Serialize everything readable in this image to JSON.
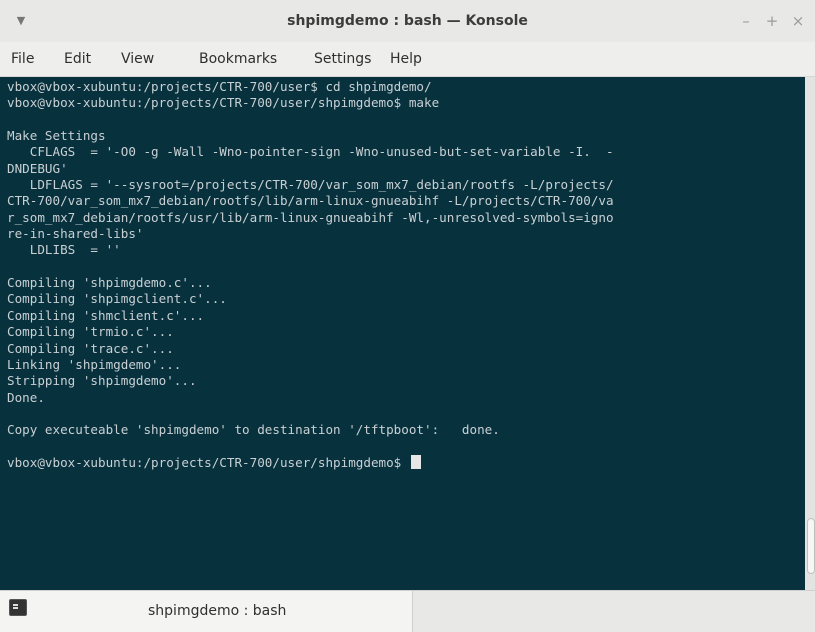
{
  "window": {
    "title": "shpimgdemo : bash — Konsole",
    "menu_icon": "chevron-down-icon",
    "controls": {
      "minimize": "–",
      "maximize": "+",
      "close": "×"
    }
  },
  "menubar": {
    "items": [
      "File",
      "Edit",
      "View",
      "Bookmarks",
      "Settings",
      "Help"
    ]
  },
  "terminal": {
    "lines": [
      "vbox@vbox-xubuntu:/projects/CTR-700/user$ cd shpimgdemo/",
      "vbox@vbox-xubuntu:/projects/CTR-700/user/shpimgdemo$ make",
      "",
      "Make Settings",
      "   CFLAGS  = '-O0 -g -Wall -Wno-pointer-sign -Wno-unused-but-set-variable -I.  -",
      "DNDEBUG'",
      "   LDFLAGS = '--sysroot=/projects/CTR-700/var_som_mx7_debian/rootfs -L/projects/",
      "CTR-700/var_som_mx7_debian/rootfs/lib/arm-linux-gnueabihf -L/projects/CTR-700/va",
      "r_som_mx7_debian/rootfs/usr/lib/arm-linux-gnueabihf -Wl,-unresolved-symbols=igno",
      "re-in-shared-libs'",
      "   LDLIBS  = ''",
      "",
      "Compiling 'shpimgdemo.c'...",
      "Compiling 'shpimgclient.c'...",
      "Compiling 'shmclient.c'...",
      "Compiling 'trmio.c'...",
      "Compiling 'trace.c'...",
      "Linking 'shpimgdemo'...",
      "Stripping 'shpimgdemo'...",
      "Done.",
      "",
      "Copy executeable 'shpimgdemo' to destination '/tftpboot':   done.",
      ""
    ],
    "prompt": "vbox@vbox-xubuntu:/projects/CTR-700/user/shpimgdemo$ ",
    "colors": {
      "background": "#07313d",
      "foreground": "#c9d0d4"
    }
  },
  "tabbar": {
    "tab_label": "shpimgdemo : bash",
    "tab_icon": "terminal-icon"
  }
}
